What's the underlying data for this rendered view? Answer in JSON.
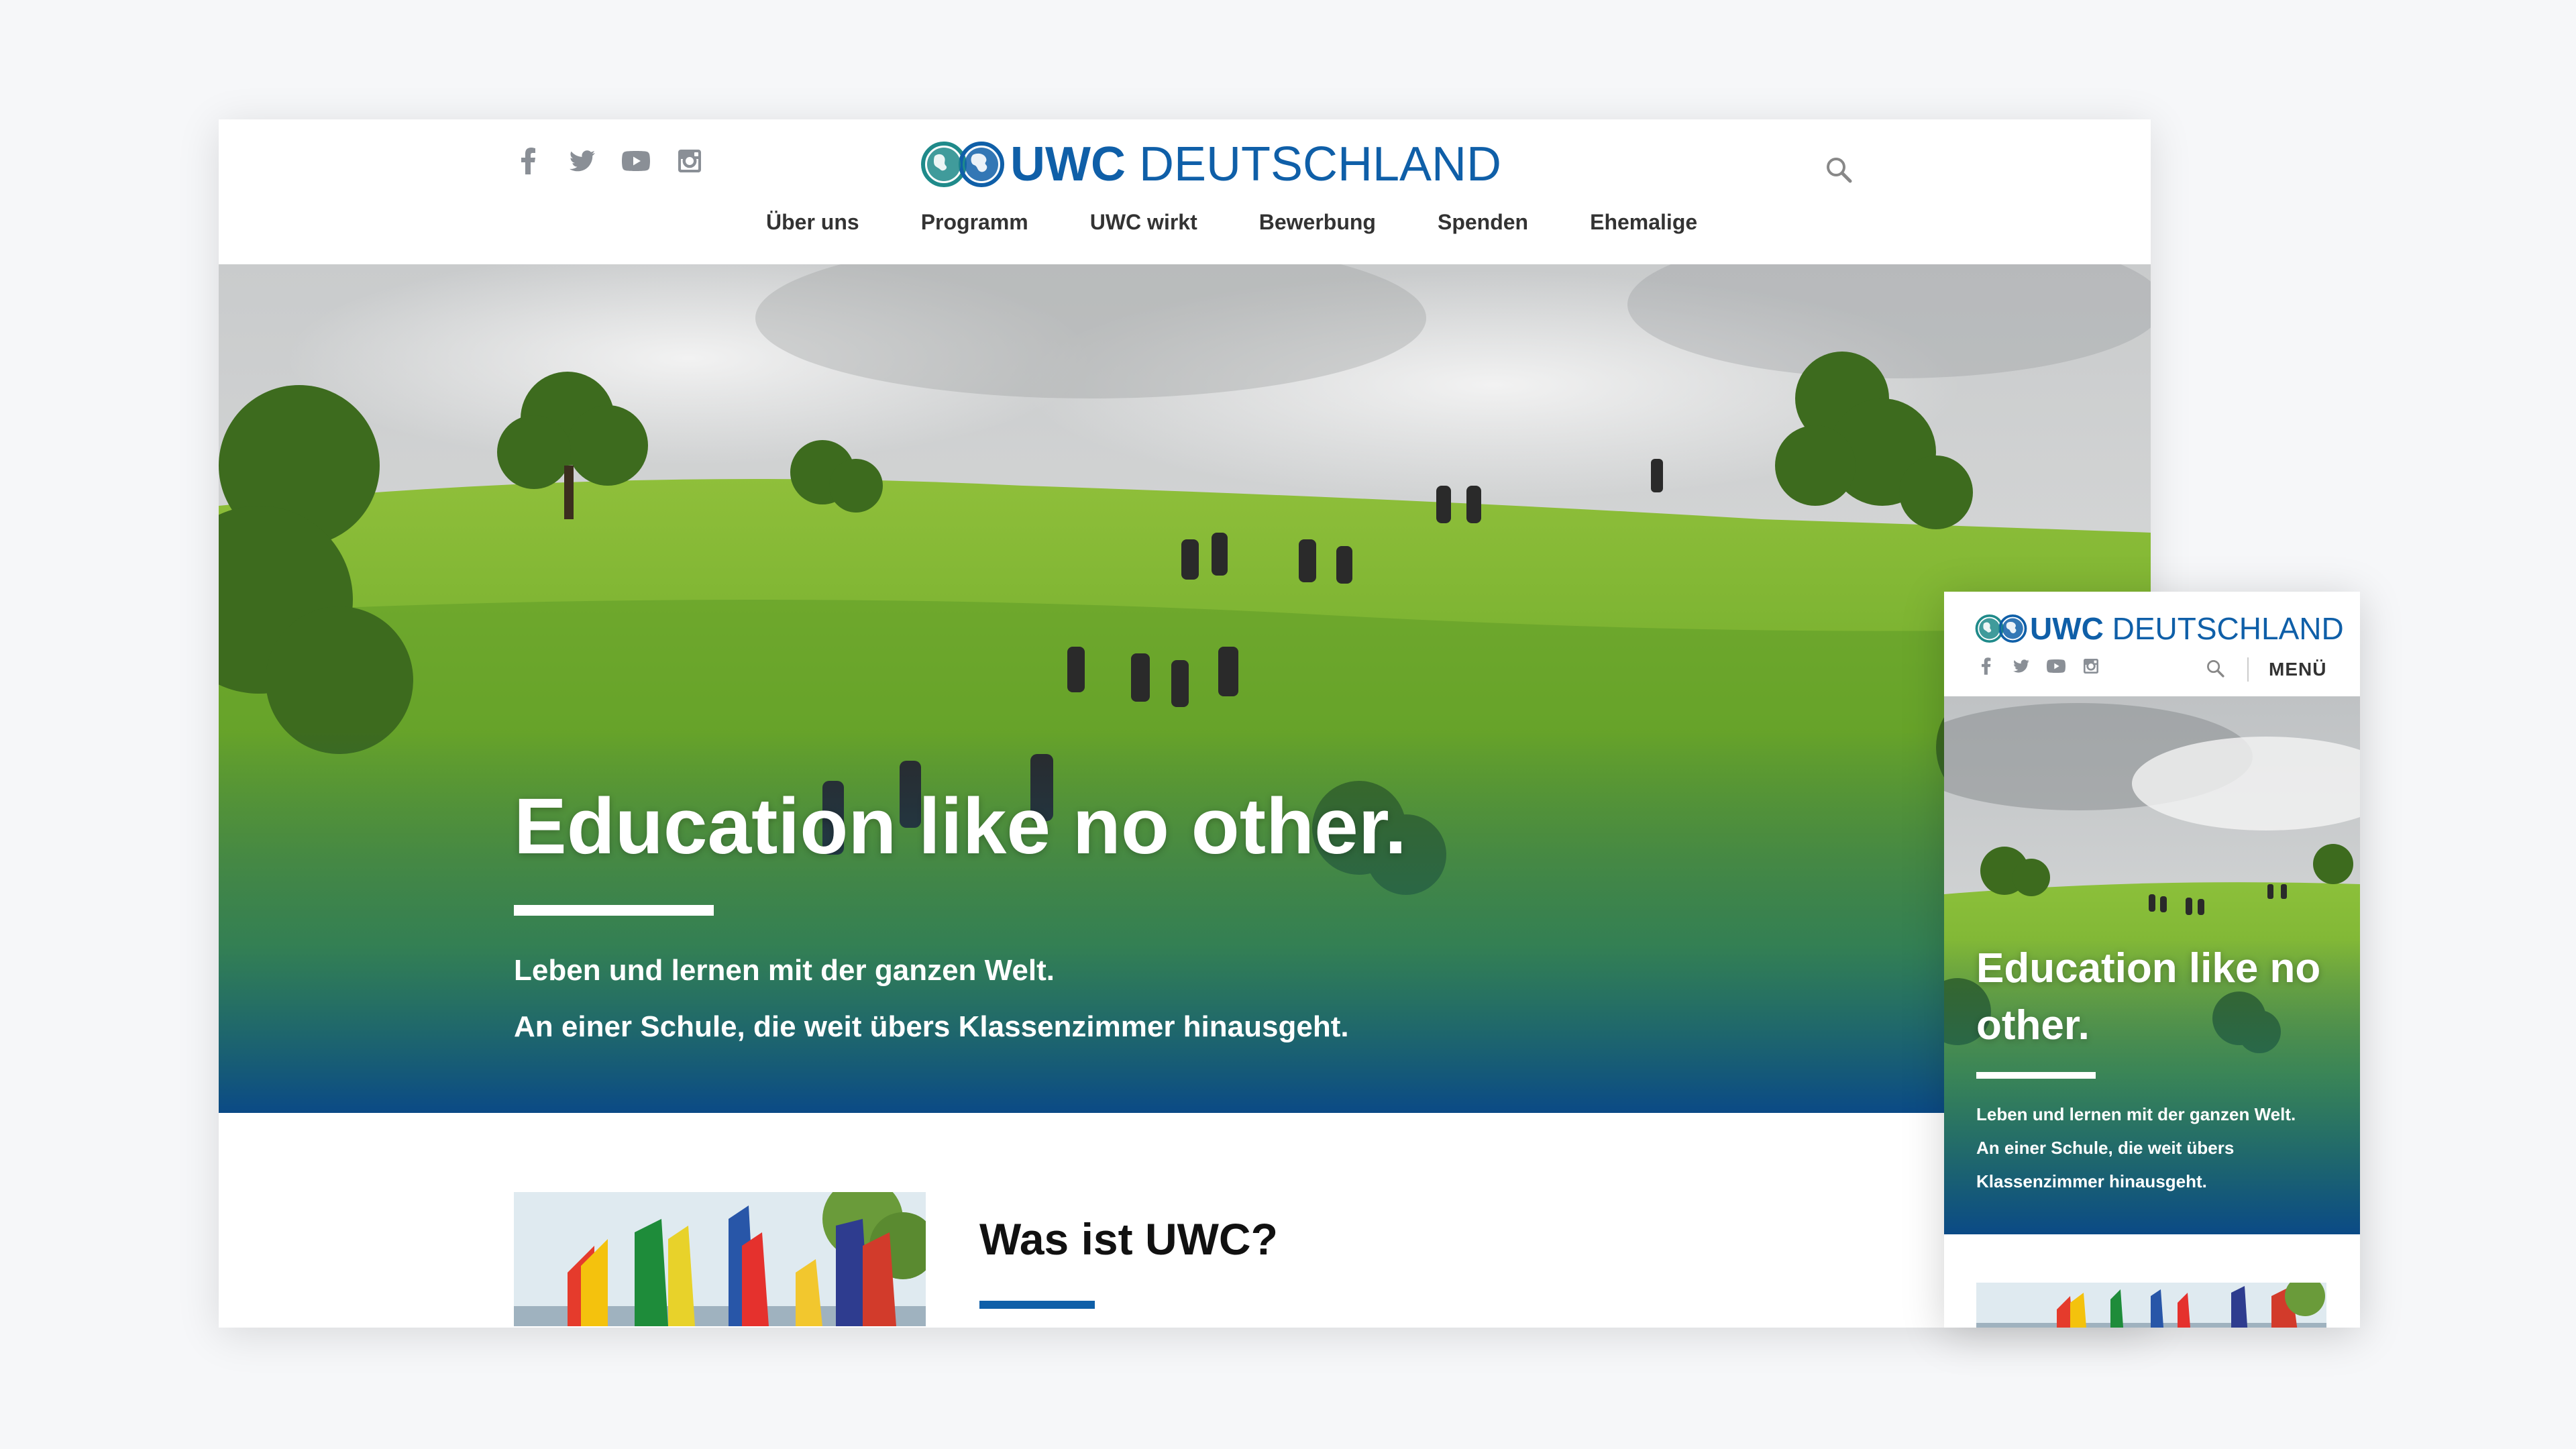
{
  "brand": {
    "name_bold": "UWC",
    "name_rest": " DEUTSCHLAND",
    "blue": "#0f5fa8",
    "teal": "#1f8a8a"
  },
  "social_icons": [
    "facebook-icon",
    "twitter-icon",
    "youtube-icon",
    "instagram-icon"
  ],
  "nav": {
    "items": [
      "Über uns",
      "Programm",
      "UWC wirkt",
      "Bewerbung",
      "Spenden",
      "Ehemalige"
    ]
  },
  "hero": {
    "title": "Education like no other.",
    "title_mobile_line1": "Education like no",
    "title_mobile_line2": "other.",
    "subtitle_line1": "Leben und lernen mit der ganzen Welt.",
    "subtitle_line2": "An einer Schule, die weit übers Klassenzimmer hinausgeht.",
    "mobile_sub_line1": "Leben und lernen mit der ganzen Welt.",
    "mobile_sub_line2": "An einer Schule, die weit übers",
    "mobile_sub_line3": "Klassenzimmer hinausgeht.",
    "gradient_color": "#0b4a86"
  },
  "section": {
    "title": "Was ist UWC?"
  },
  "mobile": {
    "menu_label": "MENÜ"
  }
}
